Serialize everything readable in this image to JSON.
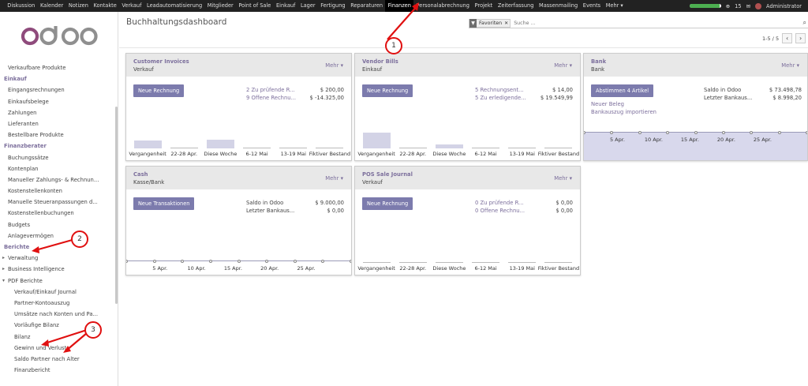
{
  "topnav": {
    "items": [
      "Diskussion",
      "Kalender",
      "Notizen",
      "Kontakte",
      "Verkauf",
      "Leadautomatisierung",
      "Mitglieder",
      "Point of Sale",
      "Einkauf",
      "Lager",
      "Fertigung",
      "Reparaturen",
      "Finanzen",
      "Personalabrechnung",
      "Projekt",
      "Zeiterfassung",
      "Massenmailing",
      "Events",
      "Mehr ▾"
    ],
    "active": "Finanzen",
    "progress": 0.95,
    "notif_count": "15",
    "user": "Administrator"
  },
  "sidebar": {
    "logo_text": "odoo",
    "items": [
      {
        "label": "Verkaufbare Produkte",
        "kind": "item"
      },
      {
        "label": "Einkauf",
        "kind": "header"
      },
      {
        "label": "Eingangsrechnungen",
        "kind": "item"
      },
      {
        "label": "Einkaufsbelege",
        "kind": "item"
      },
      {
        "label": "Zahlungen",
        "kind": "item"
      },
      {
        "label": "Lieferanten",
        "kind": "item"
      },
      {
        "label": "Bestellbare Produkte",
        "kind": "item"
      },
      {
        "label": "Finanzberater",
        "kind": "header"
      },
      {
        "label": "Buchungssätze",
        "kind": "item"
      },
      {
        "label": "Kontenplan",
        "kind": "item"
      },
      {
        "label": "Manueller Zahlungs- & Rechnun...",
        "kind": "item"
      },
      {
        "label": "Kostenstellenkonten",
        "kind": "item"
      },
      {
        "label": "Manuelle Steueranpassungen d...",
        "kind": "item"
      },
      {
        "label": "Kostenstellenbuchungen",
        "kind": "item"
      },
      {
        "label": "Budgets",
        "kind": "item"
      },
      {
        "label": "Anlagevermögen",
        "kind": "item"
      },
      {
        "label": "Berichte",
        "kind": "header"
      },
      {
        "label": "Verwaltung",
        "kind": "toggle"
      },
      {
        "label": "Business Intelligence",
        "kind": "toggle"
      },
      {
        "label": "PDF Berichte",
        "kind": "toggle-open"
      },
      {
        "label": "Verkauf/Einkauf Journal",
        "kind": "sub"
      },
      {
        "label": "Partner-Kontoauszug",
        "kind": "sub"
      },
      {
        "label": "Umsätze nach Konten und Pa...",
        "kind": "sub"
      },
      {
        "label": "Vorläufige Bilanz",
        "kind": "sub"
      },
      {
        "label": "Bilanz",
        "kind": "sub"
      },
      {
        "label": "Gewinn und Verlust",
        "kind": "sub"
      },
      {
        "label": "Saldo Partner nach Alter",
        "kind": "sub"
      },
      {
        "label": "Finanzbericht",
        "kind": "sub"
      }
    ]
  },
  "header": {
    "title": "Buchhaltungsdashboard",
    "facet": "Favoriten",
    "search_placeholder": "Suche ...",
    "pager": "1-5 / 5"
  },
  "cards": {
    "customer_invoices": {
      "title": "Customer Invoices",
      "subtitle": "Verkauf",
      "mehr": "Mehr ▾",
      "button": "Neue Rechnung",
      "stats": [
        {
          "label": "2 Zu prüfende R...",
          "amount": "$ 200,00"
        },
        {
          "label": "9 Offene Rechnu...",
          "amount": "$ -14.325,00"
        }
      ],
      "xlabels": [
        "Vergangenheit",
        "22-28 Apr.",
        "Diese Woche",
        "6-12 Mai",
        "13-19 Mai",
        "Fiktiver Bestand"
      ],
      "bars": [
        0.5,
        0,
        0.55,
        0,
        0,
        0
      ]
    },
    "vendor_bills": {
      "title": "Vendor Bills",
      "subtitle": "Einkauf",
      "mehr": "Mehr ▾",
      "button": "Neue Rechnung",
      "stats": [
        {
          "label": "5 Rechnungsent...",
          "amount": "$ 14,00"
        },
        {
          "label": "5 Zu erledigende...",
          "amount": "$ 19.549,99"
        }
      ],
      "xlabels": [
        "Vergangenheit",
        "22-28 Apr.",
        "Diese Woche",
        "6-12 Mai",
        "13-19 Mai",
        "Fiktiver Bestand"
      ],
      "bars": [
        1.0,
        0,
        0.25,
        0,
        0,
        0
      ]
    },
    "bank": {
      "title": "Bank",
      "subtitle": "Bank",
      "mehr": "Mehr ▾",
      "button": "Abstimmen 4 Artikel",
      "links": [
        "Neuer Beleg",
        "Bankauszug importieren"
      ],
      "stats": [
        {
          "label": "Saldo in Odoo",
          "amount": "$ 73.498,78"
        },
        {
          "label": "Letzter Bankaus...",
          "amount": "$ 8.998,20"
        }
      ],
      "xlabels": [
        "5 Apr.",
        "10 Apr.",
        "15 Apr.",
        "20 Apr.",
        "25 Apr."
      ]
    },
    "cash": {
      "title": "Cash",
      "subtitle": "Kasse/Bank",
      "mehr": "Mehr ▾",
      "button": "Neue Transaktionen",
      "stats": [
        {
          "label": "Saldo in Odoo",
          "amount": "$ 9.000,00"
        },
        {
          "label": "Letzter Bankaus...",
          "amount": "$ 0,00"
        }
      ],
      "xlabels": [
        "5 Apr.",
        "10 Apr.",
        "15 Apr.",
        "20 Apr.",
        "25 Apr."
      ]
    },
    "pos": {
      "title": "POS Sale Journal",
      "subtitle": "Verkauf",
      "mehr": "Mehr ▾",
      "button": "Neue Rechnung",
      "stats": [
        {
          "label": "0 Zu prüfende R...",
          "amount": "$ 0,00"
        },
        {
          "label": "0 Offene Rechnu...",
          "amount": "$ 0,00"
        }
      ],
      "xlabels": [
        "Vergangenheit",
        "22-28 Apr.",
        "Diese Woche",
        "6-12 Mai",
        "13-19 Mai",
        "Fiktiver Bestand"
      ],
      "bars": [
        0,
        0,
        0,
        0,
        0,
        0
      ]
    }
  },
  "annotations": [
    "1",
    "2",
    "3"
  ],
  "colors": {
    "accent": "#7c6f9c",
    "button": "#7c7bad",
    "annotation": "#e01010",
    "topbar": "#222222"
  }
}
